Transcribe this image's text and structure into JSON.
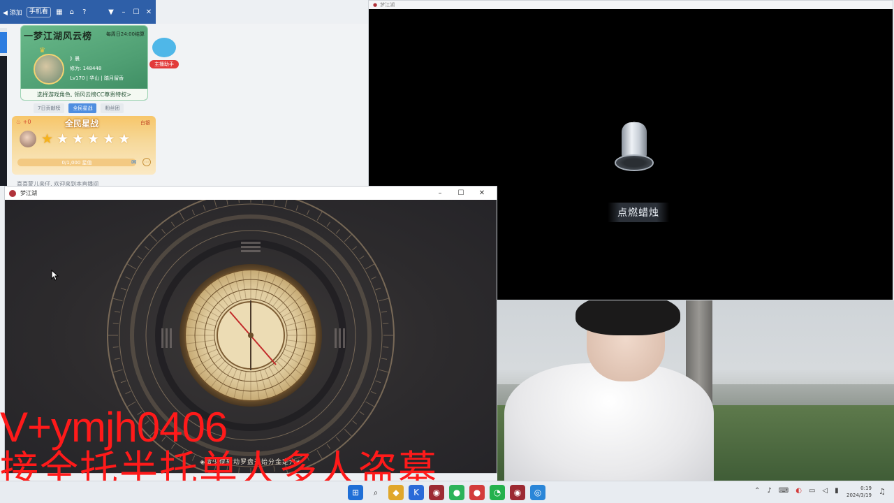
{
  "tool_strip": {
    "sound_label": "◀ 添加",
    "chip_1": "手机看",
    "icons": [
      "grid-icon",
      "pin-icon",
      "help-icon",
      "dropdown-icon",
      "minimize-icon",
      "maximize-icon",
      "close-icon"
    ]
  },
  "rank_card": {
    "title": "一梦江湖风云榜",
    "reset_time": "每周日24:00结算",
    "player_name": "》晨",
    "power_label": "修为: 148448",
    "level_info": "Lv170 | 华山 | 踏月留香",
    "cta": "选择游戏角色, 领风云榜CC尊贵特权>"
  },
  "mascot": {
    "badge": "主播助手"
  },
  "rank_tabs": [
    {
      "label": "7日贡献榜",
      "active": false
    },
    {
      "label": "全民星战",
      "active": true
    },
    {
      "label": "粉丝团",
      "active": false
    }
  ],
  "star_card": {
    "heat": "+0",
    "title": "全民星战",
    "bow": "白银",
    "stars_total": 6,
    "stars_lit": 1,
    "progress_text": "0/1,000 星值"
  },
  "chat_peek": "喜喜蒙儿来仔, 欢迎来到本直播间",
  "right_window": {
    "title": "梦江湖",
    "action_button": "点燃蜡烛"
  },
  "front_window": {
    "title": "梦江湖",
    "controls": [
      "–",
      "☐",
      "✕"
    ],
    "hint": "◈请少侠转动罗盘开始分金定穴◈"
  },
  "overlay": {
    "line_1": "V+ymjh0406",
    "line_2": "接全托半托单人多人盗墓"
  },
  "taskbar": {
    "apps": [
      {
        "name": "windows-start-icon",
        "glyph": "⊞",
        "color": "#1f6fd6"
      },
      {
        "name": "search-icon",
        "glyph": "⌕",
        "color": "#333333"
      },
      {
        "name": "files-icon",
        "glyph": "◆",
        "color": "#e0a72b"
      },
      {
        "name": "app-k-icon",
        "glyph": "K",
        "color": "#2a6ad8"
      },
      {
        "name": "game-icon-1",
        "glyph": "◉",
        "color": "#9c2a33"
      },
      {
        "name": "app-green-icon",
        "glyph": "●",
        "color": "#2bb35a"
      },
      {
        "name": "app-red-icon",
        "glyph": "●",
        "color": "#d33b3b"
      },
      {
        "name": "wechat-icon",
        "glyph": "◔",
        "color": "#23b14d"
      },
      {
        "name": "game-icon-2",
        "glyph": "◉",
        "color": "#9c2a33"
      },
      {
        "name": "browser-icon",
        "glyph": "◎",
        "color": "#2a86d8"
      }
    ],
    "clock_time": "0:19",
    "clock_date": "2024/3/19"
  }
}
